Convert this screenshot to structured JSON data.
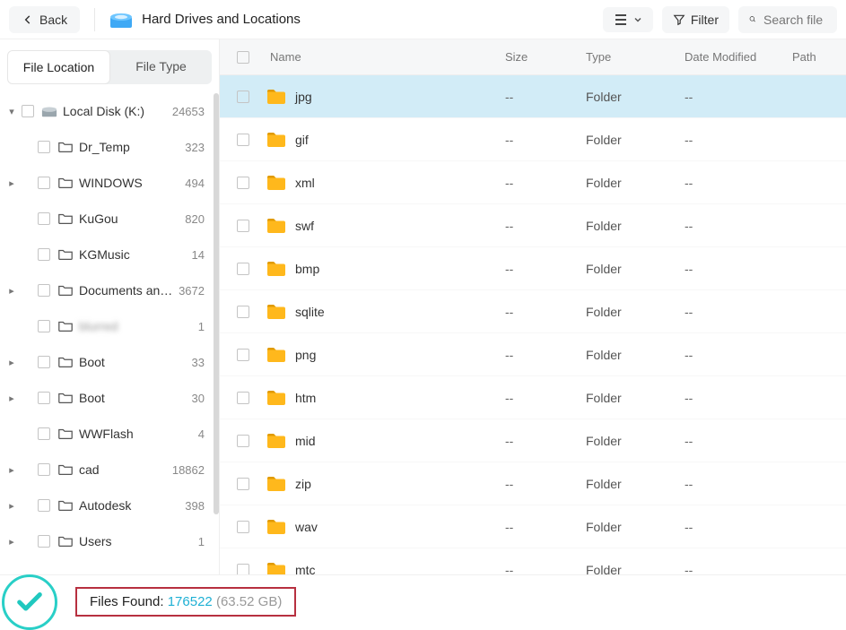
{
  "header": {
    "back": "Back",
    "title": "Hard Drives and Locations",
    "filter": "Filter",
    "search_placeholder": "Search file"
  },
  "sidebar": {
    "tabs": {
      "location": "File Location",
      "type": "File Type"
    },
    "items": [
      {
        "caret": "▾",
        "icon": "disk",
        "label": "Local Disk (K:)",
        "count": "24653",
        "indent": 0
      },
      {
        "caret": "",
        "icon": "folder",
        "label": "Dr_Temp",
        "count": "323",
        "indent": 1
      },
      {
        "caret": "▸",
        "icon": "folder",
        "label": "WINDOWS",
        "count": "494",
        "indent": 1
      },
      {
        "caret": "",
        "icon": "folder",
        "label": "KuGou",
        "count": "820",
        "indent": 1
      },
      {
        "caret": "",
        "icon": "folder",
        "label": "KGMusic",
        "count": "14",
        "indent": 1
      },
      {
        "caret": "▸",
        "icon": "folder",
        "label": "Documents and Set...",
        "count": "3672",
        "indent": 1
      },
      {
        "caret": "",
        "icon": "folder",
        "label": "blurred",
        "count": "1",
        "indent": 1,
        "blur": true
      },
      {
        "caret": "▸",
        "icon": "folder",
        "label": "Boot",
        "count": "33",
        "indent": 1
      },
      {
        "caret": "▸",
        "icon": "folder",
        "label": "Boot",
        "count": "30",
        "indent": 1
      },
      {
        "caret": "",
        "icon": "folder",
        "label": "WWFlash",
        "count": "4",
        "indent": 1
      },
      {
        "caret": "▸",
        "icon": "folder",
        "label": "cad",
        "count": "18862",
        "indent": 1
      },
      {
        "caret": "▸",
        "icon": "folder",
        "label": "Autodesk",
        "count": "398",
        "indent": 1
      },
      {
        "caret": "▸",
        "icon": "folder",
        "label": "Users",
        "count": "1",
        "indent": 1
      }
    ]
  },
  "columns": {
    "name": "Name",
    "size": "Size",
    "type": "Type",
    "date": "Date Modified",
    "path": "Path"
  },
  "rows": [
    {
      "name": "jpg",
      "size": "--",
      "type": "Folder",
      "date": "--",
      "selected": true
    },
    {
      "name": "gif",
      "size": "--",
      "type": "Folder",
      "date": "--"
    },
    {
      "name": "xml",
      "size": "--",
      "type": "Folder",
      "date": "--"
    },
    {
      "name": "swf",
      "size": "--",
      "type": "Folder",
      "date": "--"
    },
    {
      "name": "bmp",
      "size": "--",
      "type": "Folder",
      "date": "--"
    },
    {
      "name": "sqlite",
      "size": "--",
      "type": "Folder",
      "date": "--"
    },
    {
      "name": "png",
      "size": "--",
      "type": "Folder",
      "date": "--"
    },
    {
      "name": "htm",
      "size": "--",
      "type": "Folder",
      "date": "--"
    },
    {
      "name": "mid",
      "size": "--",
      "type": "Folder",
      "date": "--"
    },
    {
      "name": "zip",
      "size": "--",
      "type": "Folder",
      "date": "--"
    },
    {
      "name": "wav",
      "size": "--",
      "type": "Folder",
      "date": "--"
    },
    {
      "name": "mtc",
      "size": "--",
      "type": "Folder",
      "date": "--"
    }
  ],
  "footer": {
    "label": "Files Found: ",
    "count": "176522",
    "size": " (63.52 GB)"
  }
}
